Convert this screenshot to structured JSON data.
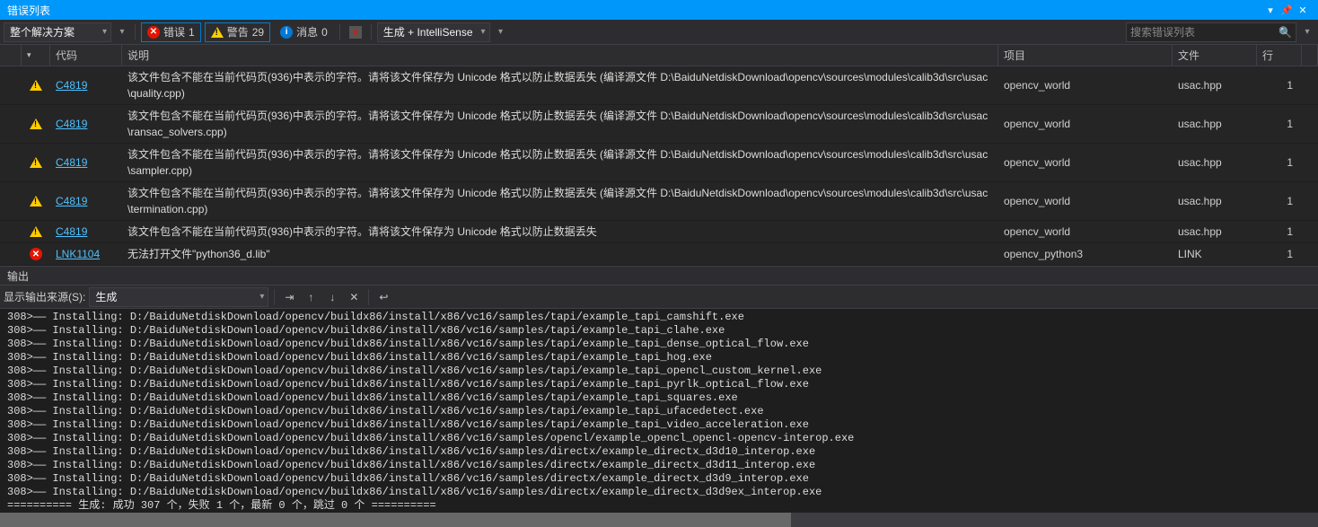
{
  "panel": {
    "error_list_title": "错误列表",
    "output_title": "输出"
  },
  "toolbar": {
    "scope": "整个解决方案",
    "errors_label": "错误",
    "errors_count": "1",
    "warnings_label": "警告",
    "warnings_count": "29",
    "messages_label": "消息",
    "messages_count": "0",
    "build_source": "生成 + IntelliSense",
    "search_placeholder": "搜索错误列表"
  },
  "columns": {
    "code": "代码",
    "description": "说明",
    "project": "项目",
    "file": "文件",
    "line": "行"
  },
  "rows": [
    {
      "sev": "warn",
      "code": "C4819",
      "desc": "该文件包含不能在当前代码页(936)中表示的字符。请将该文件保存为 Unicode 格式以防止数据丢失 (编译源文件 D:\\BaiduNetdiskDownload\\opencv\\sources\\modules\\calib3d\\src\\usac\\quality.cpp)",
      "project": "opencv_world",
      "file": "usac.hpp",
      "line": "1"
    },
    {
      "sev": "warn",
      "code": "C4819",
      "desc": "该文件包含不能在当前代码页(936)中表示的字符。请将该文件保存为 Unicode 格式以防止数据丢失 (编译源文件 D:\\BaiduNetdiskDownload\\opencv\\sources\\modules\\calib3d\\src\\usac\\ransac_solvers.cpp)",
      "project": "opencv_world",
      "file": "usac.hpp",
      "line": "1"
    },
    {
      "sev": "warn",
      "code": "C4819",
      "desc": "该文件包含不能在当前代码页(936)中表示的字符。请将该文件保存为 Unicode 格式以防止数据丢失 (编译源文件 D:\\BaiduNetdiskDownload\\opencv\\sources\\modules\\calib3d\\src\\usac\\sampler.cpp)",
      "project": "opencv_world",
      "file": "usac.hpp",
      "line": "1"
    },
    {
      "sev": "warn",
      "code": "C4819",
      "desc": "该文件包含不能在当前代码页(936)中表示的字符。请将该文件保存为 Unicode 格式以防止数据丢失 (编译源文件 D:\\BaiduNetdiskDownload\\opencv\\sources\\modules\\calib3d\\src\\usac\\termination.cpp)",
      "project": "opencv_world",
      "file": "usac.hpp",
      "line": "1"
    },
    {
      "sev": "warn",
      "code": "C4819",
      "desc": "该文件包含不能在当前代码页(936)中表示的字符。请将该文件保存为 Unicode 格式以防止数据丢失",
      "project": "opencv_world",
      "file": "usac.hpp",
      "line": "1"
    },
    {
      "sev": "err",
      "code": "LNK1104",
      "desc": "无法打开文件\"python36_d.lib\"",
      "project": "opencv_python3",
      "file": "LINK",
      "line": "1"
    }
  ],
  "output_toolbar": {
    "label": "显示输出来源(S):",
    "source": "生成"
  },
  "output_lines": [
    "308>—— Installing: D:/BaiduNetdiskDownload/opencv/buildx86/install/x86/vc16/samples/tapi/example_tapi_camshift.exe",
    "308>—— Installing: D:/BaiduNetdiskDownload/opencv/buildx86/install/x86/vc16/samples/tapi/example_tapi_clahe.exe",
    "308>—— Installing: D:/BaiduNetdiskDownload/opencv/buildx86/install/x86/vc16/samples/tapi/example_tapi_dense_optical_flow.exe",
    "308>—— Installing: D:/BaiduNetdiskDownload/opencv/buildx86/install/x86/vc16/samples/tapi/example_tapi_hog.exe",
    "308>—— Installing: D:/BaiduNetdiskDownload/opencv/buildx86/install/x86/vc16/samples/tapi/example_tapi_opencl_custom_kernel.exe",
    "308>—— Installing: D:/BaiduNetdiskDownload/opencv/buildx86/install/x86/vc16/samples/tapi/example_tapi_pyrlk_optical_flow.exe",
    "308>—— Installing: D:/BaiduNetdiskDownload/opencv/buildx86/install/x86/vc16/samples/tapi/example_tapi_squares.exe",
    "308>—— Installing: D:/BaiduNetdiskDownload/opencv/buildx86/install/x86/vc16/samples/tapi/example_tapi_ufacedetect.exe",
    "308>—— Installing: D:/BaiduNetdiskDownload/opencv/buildx86/install/x86/vc16/samples/tapi/example_tapi_video_acceleration.exe",
    "308>—— Installing: D:/BaiduNetdiskDownload/opencv/buildx86/install/x86/vc16/samples/opencl/example_opencl_opencl-opencv-interop.exe",
    "308>—— Installing: D:/BaiduNetdiskDownload/opencv/buildx86/install/x86/vc16/samples/directx/example_directx_d3d10_interop.exe",
    "308>—— Installing: D:/BaiduNetdiskDownload/opencv/buildx86/install/x86/vc16/samples/directx/example_directx_d3d11_interop.exe",
    "308>—— Installing: D:/BaiduNetdiskDownload/opencv/buildx86/install/x86/vc16/samples/directx/example_directx_d3d9_interop.exe",
    "308>—— Installing: D:/BaiduNetdiskDownload/opencv/buildx86/install/x86/vc16/samples/directx/example_directx_d3d9ex_interop.exe",
    "========== 生成: 成功 307 个，失败 1 个，最新 0 个，跳过 0 个 =========="
  ]
}
